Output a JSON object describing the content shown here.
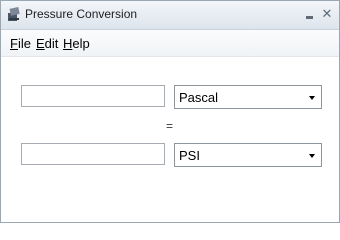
{
  "window": {
    "title": "Pressure Conversion",
    "icon": "pressure-gauge-icon",
    "minimize_icon": "minimize-icon",
    "close_icon": "close-icon",
    "close_glyph": "✕"
  },
  "menu": {
    "file": {
      "mnemonic": "F",
      "rest": "ile"
    },
    "edit": {
      "mnemonic": "E",
      "rest": "dit"
    },
    "help": {
      "mnemonic": "H",
      "rest": "elp"
    }
  },
  "converter": {
    "input_value": "",
    "input_unit": "Pascal",
    "equals_sign": "=",
    "output_value": "",
    "output_unit": "PSI",
    "dropdown_icon": "chevron-down-icon"
  }
}
